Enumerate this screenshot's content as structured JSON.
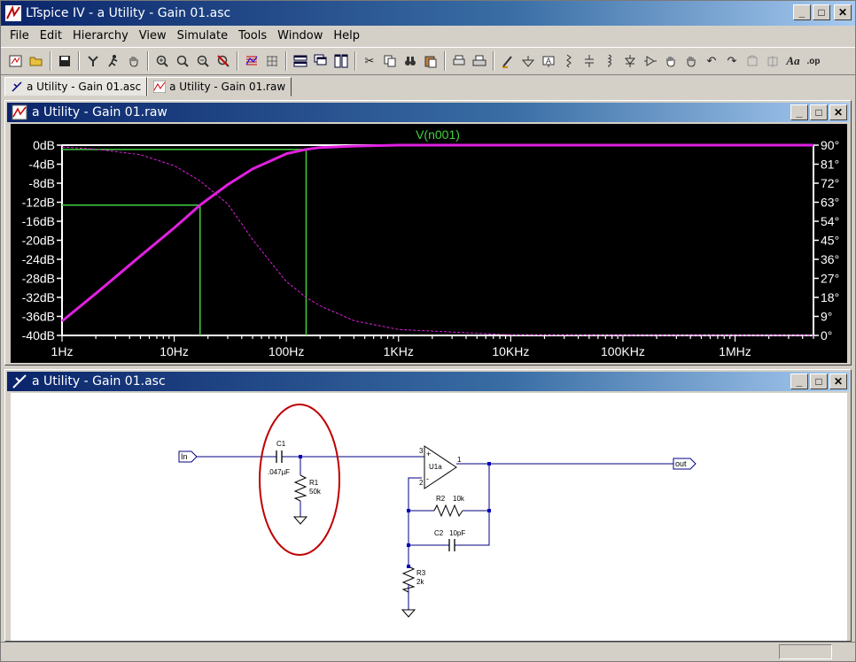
{
  "window": {
    "title": "LTspice IV - a Utility - Gain 01.asc",
    "minimize": "_",
    "maximize": "□",
    "close": "✕"
  },
  "menu": [
    "File",
    "Edit",
    "Hierarchy",
    "View",
    "Simulate",
    "Tools",
    "Window",
    "Help"
  ],
  "toolbar_icons": [
    "open-schematic-icon",
    "open-folder-icon",
    "save-icon",
    "control-panel-icon",
    "run-icon",
    "pan-hand-icon",
    "zoom-in-icon",
    "zoom-rect-icon",
    "zoom-out-icon",
    "zoom-cancel-icon",
    "autorange-icon",
    "grid-icon",
    "tile-horizontal-icon",
    "cascade-icon",
    "tile-icon",
    "cut-icon",
    "copy-icon",
    "find-icon",
    "paste-icon",
    "print-setup-icon",
    "print-icon",
    "wire-icon",
    "ground-icon",
    "label-icon",
    "resistor-icon",
    "capacitor-icon",
    "inductor-icon",
    "diode-icon",
    "component-icon",
    "move-icon",
    "drag-icon",
    "undo-icon",
    "redo-icon",
    "rotate-icon",
    "mirror-icon",
    "text-icon",
    "spice-directive-icon"
  ],
  "tabs": [
    {
      "label": "a Utility - Gain 01.asc",
      "icon": "schematic-icon"
    },
    {
      "label": "a Utility - Gain 01.raw",
      "icon": "waveform-icon"
    }
  ],
  "plot_window": {
    "title": "a Utility - Gain 01.raw"
  },
  "schematic_window": {
    "title": "a Utility - Gain 01.asc"
  },
  "schematic": {
    "in_label": "In",
    "out_label": "out",
    "c1_name": "C1",
    "c1_value": ".047µF",
    "r1_name": "R1",
    "r1_value": "50k",
    "r2_name": "R2",
    "r2_value": "10k",
    "c2_name": "C2",
    "c2_value": "10pF",
    "r3_name": "R3",
    "r3_value": "2k",
    "u1_name": "U1a",
    "pin3": "3",
    "pin2": "2",
    "pin1": "1",
    "plus": "+",
    "minus": "-"
  },
  "colors": {
    "magnitude": "#e020e0",
    "cursor": "#40d040",
    "trace_label": "#40d040",
    "wire": "#000080",
    "junction": "#0000c0",
    "highlight_ellipse": "#c00000"
  },
  "chart_data": {
    "type": "line",
    "title": "V(n001)",
    "x_scale": "log",
    "x_range": [
      1,
      5000000
    ],
    "x_ticks": [
      {
        "value": 1,
        "label": "1Hz"
      },
      {
        "value": 10,
        "label": "10Hz"
      },
      {
        "value": 100,
        "label": "100Hz"
      },
      {
        "value": 1000,
        "label": "1KHz"
      },
      {
        "value": 10000,
        "label": "10KHz"
      },
      {
        "value": 100000,
        "label": "100KHz"
      },
      {
        "value": 1000000,
        "label": "1MHz"
      }
    ],
    "y_left_range": [
      -40,
      0
    ],
    "y_left_ticks": [
      "0dB",
      "-4dB",
      "-8dB",
      "-12dB",
      "-16dB",
      "-20dB",
      "-24dB",
      "-28dB",
      "-32dB",
      "-36dB",
      "-40dB"
    ],
    "y_right_range": [
      0,
      90
    ],
    "y_right_ticks": [
      "90°",
      "81°",
      "72°",
      "63°",
      "54°",
      "45°",
      "36°",
      "27°",
      "18°",
      "9°",
      "0°"
    ],
    "series": [
      {
        "name": "V(n001)",
        "axis": "magnitude",
        "x": [
          1,
          2,
          5,
          10,
          17,
          30,
          50,
          100,
          150,
          200,
          400,
          1000,
          10000,
          100000,
          1000000,
          5000000
        ],
        "y": [
          -37,
          -31.2,
          -23.3,
          -17.4,
          -12.6,
          -8.3,
          -5.0,
          -1.8,
          -0.9,
          -0.5,
          -0.2,
          0,
          0,
          0,
          0,
          0
        ]
      },
      {
        "name": "phase",
        "axis": "phase",
        "x": [
          1,
          2,
          5,
          10,
          17,
          30,
          50,
          100,
          150,
          200,
          400,
          1000,
          10000,
          100000,
          1000000,
          5000000
        ],
        "y": [
          89.1,
          88.1,
          85.5,
          80.3,
          73.1,
          62.2,
          45.3,
          25.4,
          18.0,
          14.0,
          7.0,
          2.8,
          0.3,
          0,
          0,
          0
        ]
      }
    ],
    "cursors": [
      {
        "x": 17,
        "y": -12.6
      },
      {
        "x": 150,
        "y": -0.9
      }
    ]
  }
}
